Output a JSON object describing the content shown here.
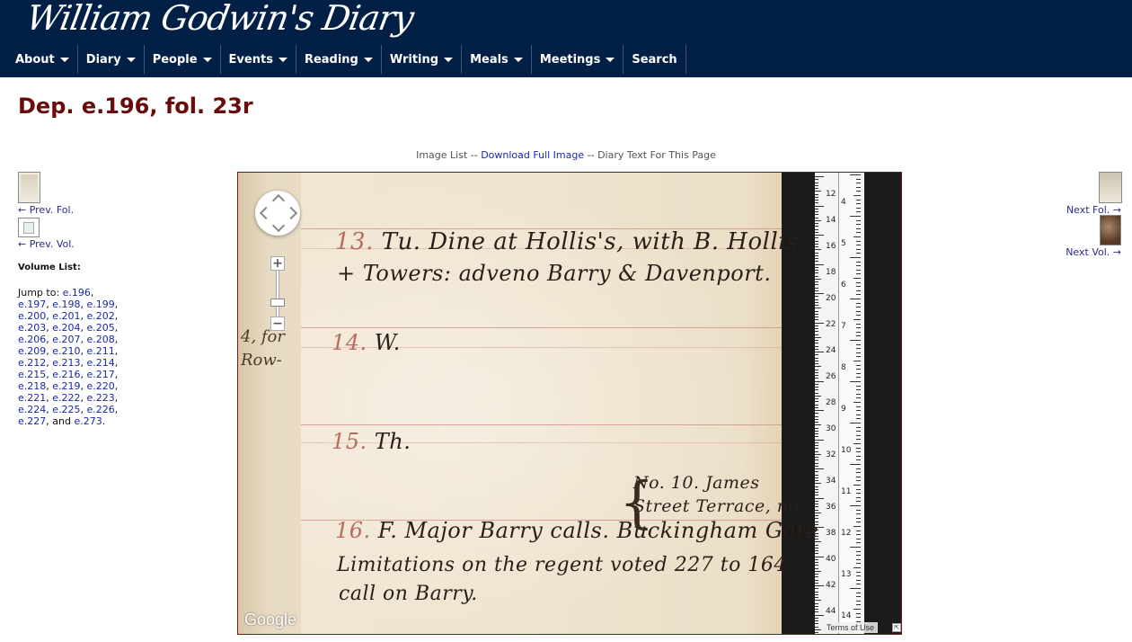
{
  "header": {
    "logo_text": "William Godwin's Diary",
    "nav": [
      {
        "label": "About"
      },
      {
        "label": "Diary"
      },
      {
        "label": "People"
      },
      {
        "label": "Events"
      },
      {
        "label": "Reading"
      },
      {
        "label": "Writing"
      },
      {
        "label": "Meals"
      },
      {
        "label": "Meetings"
      },
      {
        "label": "Search"
      }
    ],
    "colors": {
      "background": "#021f46",
      "title": "#6a0a0a",
      "link": "#1a28a8"
    }
  },
  "page_title": "Dep. e.196, fol. 23r",
  "image_links": {
    "image_list": "Image List",
    "sep1": " -- ",
    "download": "Download Full Image",
    "sep2": " -- ",
    "diary_text": "Diary Text For This Page"
  },
  "left": {
    "prev_fol": "←  Prev. Fol.",
    "prev_vol": "←  Prev. Vol.",
    "volume_list_label": "Volume List:",
    "jump_to": "Jump to: ",
    "volumes": [
      "e.196",
      "e.197",
      "e.198",
      "e.199",
      "e.200",
      "e.201",
      "e.202",
      "e.203",
      "e.204",
      "e.205",
      "e.206",
      "e.207",
      "e.208",
      "e.209",
      "e.210",
      "e.211",
      "e.212",
      "e.213",
      "e.214",
      "e.215",
      "e.216",
      "e.217",
      "e.218",
      "e.219",
      "e.220",
      "e.221",
      "e.222",
      "e.223",
      "e.224",
      "e.225",
      "e.226",
      "e.227",
      "e.273"
    ],
    "and_word": " and "
  },
  "right": {
    "next_fol": "Next Fol.  →",
    "next_vol": "Next Vol.  →"
  },
  "viewer": {
    "entries": [
      {
        "num": "13.",
        "text": " Tu. Dine at Hollis's, with B. Hollis"
      },
      {
        "num": "",
        "text": "+ Towers: adveno Barry & Davenport."
      },
      {
        "num": "14.",
        "text": " W."
      },
      {
        "num": "15.",
        "text": " Th."
      },
      {
        "num": "",
        "text": "No. 10. James"
      },
      {
        "num": "",
        "text": "Street Terrace, no"
      },
      {
        "num": "16.",
        "text": " F. Major Barry calls. Buckingham Gate"
      },
      {
        "num": "",
        "text": "Limitations on the regent voted 227 to 164"
      },
      {
        "num": "",
        "text": "call on Barry."
      }
    ],
    "gutter_text": "4, for\nRow-",
    "ruler_labels_left": [
      "12",
      "14",
      "16",
      "18",
      "20",
      "22",
      "24",
      "26",
      "28",
      "30",
      "32",
      "34",
      "36",
      "38",
      "40",
      "42",
      "44"
    ],
    "ruler_labels_right": [
      "4",
      "5",
      "6",
      "7",
      "8",
      "9",
      "10",
      "11",
      "12",
      "13",
      "14"
    ],
    "zoom_in": "+",
    "zoom_out": "−",
    "google_label": "Google",
    "terms": "Terms of Use",
    "icons": [
      "pan-control-icon",
      "zoom-in-icon",
      "zoom-out-icon",
      "fullscreen-icon"
    ]
  }
}
